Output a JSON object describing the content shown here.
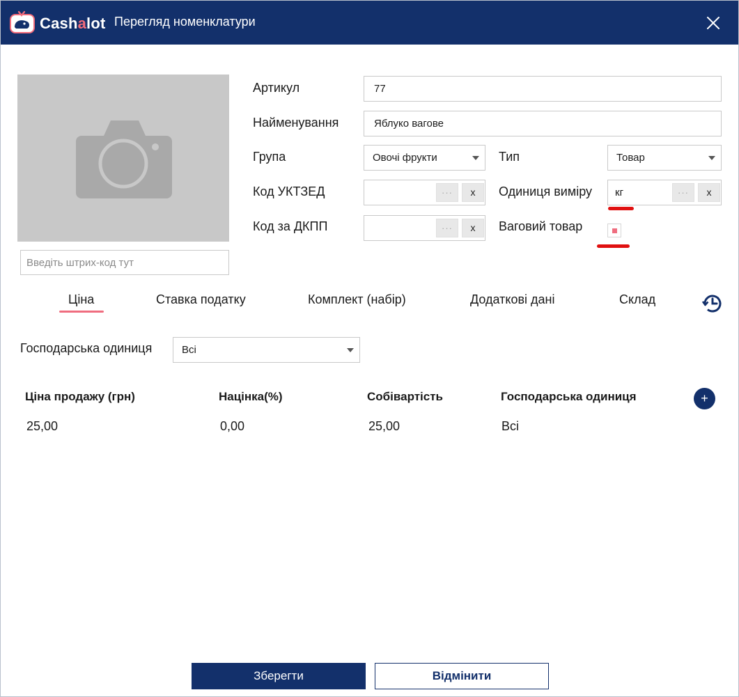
{
  "app": {
    "brand": "Cash",
    "brand_accent": "a",
    "brand_end": "lot",
    "title": "Перегляд номенклатури"
  },
  "barcode": {
    "placeholder": "Введіть штрих-код тут",
    "value": ""
  },
  "form": {
    "article": {
      "label": "Артикул",
      "value": "77"
    },
    "name": {
      "label": "Найменування",
      "value": "Яблуко вагове"
    },
    "group": {
      "label": "Група",
      "value": "Овочі фрукти"
    },
    "type": {
      "label": "Тип",
      "value": "Товар"
    },
    "uktzed": {
      "label": "Код УКТЗЕД",
      "value": "",
      "dots": "···",
      "clear": "x"
    },
    "unit": {
      "label": "Одиниця виміру",
      "value": "кг",
      "dots": "···",
      "clear": "x"
    },
    "dkpp": {
      "label": "Код за ДКПП",
      "value": "",
      "dots": "···",
      "clear": "x"
    },
    "weighted": {
      "label": "Ваговий товар",
      "checked": true
    }
  },
  "tabs": [
    {
      "label": "Ціна",
      "active": true
    },
    {
      "label": "Ставка податку",
      "active": false
    },
    {
      "label": "Комплект (набір)",
      "active": false
    },
    {
      "label": "Додаткові дані",
      "active": false
    },
    {
      "label": "Склад",
      "active": false
    }
  ],
  "filter": {
    "label": "Господарська одиниця",
    "value": "Всі"
  },
  "price_table": {
    "headers": [
      "Ціна продажу (грн)",
      "Націнка(%)",
      "Собівартість",
      "Господарська одиниця"
    ],
    "rows": [
      [
        "25,00",
        "0,00",
        "25,00",
        "Всі"
      ]
    ],
    "add_label": "+"
  },
  "buttons": {
    "save": "Зберегти",
    "cancel": "Відмінити"
  },
  "colors": {
    "header_bg": "#13306b",
    "accent": "#ef6d7f",
    "annotation": "#e01010",
    "photo_bg": "#c8c8c8"
  },
  "icons": {
    "logo": "cashalot-whale-logo-icon",
    "close": "close-icon",
    "photo": "camera-icon",
    "history": "history-clock-icon",
    "add": "plus-icon"
  }
}
